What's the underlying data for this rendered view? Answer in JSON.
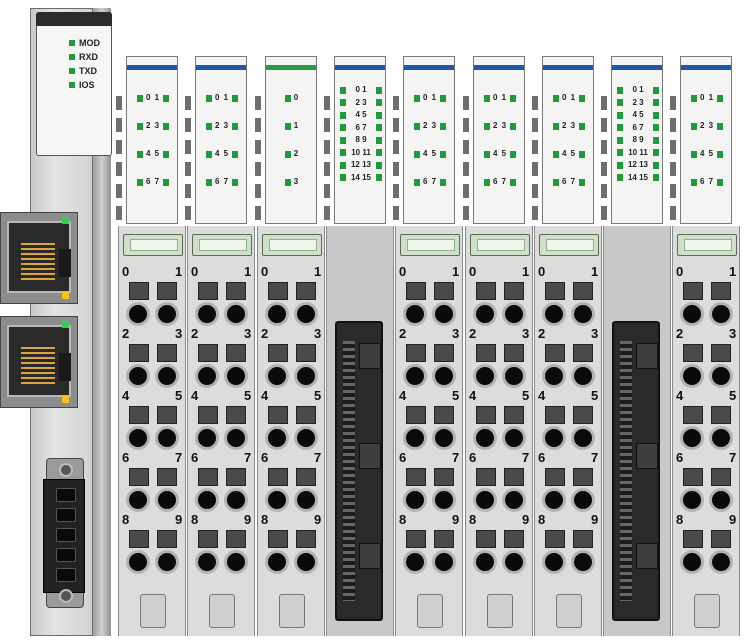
{
  "coupler": {
    "status_leds": [
      {
        "label": "MOD"
      },
      {
        "label": "RXD"
      },
      {
        "label": "TXD"
      },
      {
        "label": "IOS"
      }
    ],
    "led_color": "#1f9b3c"
  },
  "colors": {
    "blue_stripe": "#1f56a6",
    "green_stripe": "#2a9a45",
    "led_green": "#1f9b3c"
  },
  "modules": [
    {
      "type": "8ch",
      "stripe": "blue",
      "leds": [
        "0 1",
        "2 3",
        "4 5",
        "6 7"
      ],
      "terminals": [
        "0",
        "1",
        "2",
        "3",
        "4",
        "5",
        "6",
        "7",
        "8",
        "9"
      ]
    },
    {
      "type": "8ch",
      "stripe": "blue",
      "leds": [
        "0 1",
        "2 3",
        "4 5",
        "6 7"
      ],
      "terminals": [
        "0",
        "1",
        "2",
        "3",
        "4",
        "5",
        "6",
        "7",
        "8",
        "9"
      ]
    },
    {
      "type": "4ch",
      "stripe": "green",
      "leds": [
        "0",
        "1",
        "2",
        "3"
      ],
      "terminals": [
        "0",
        "1",
        "2",
        "3",
        "4",
        "5",
        "6",
        "7",
        "8",
        "9"
      ]
    },
    {
      "type": "16ch",
      "stripe": "blue",
      "leds": [
        "0 1",
        "2 3",
        "4 5",
        "6 7",
        "8 9",
        "10 11",
        "12 13",
        "14 15"
      ],
      "terminals": []
    },
    {
      "type": "8ch",
      "stripe": "blue",
      "leds": [
        "0 1",
        "2 3",
        "4 5",
        "6 7"
      ],
      "terminals": [
        "0",
        "1",
        "2",
        "3",
        "4",
        "5",
        "6",
        "7",
        "8",
        "9"
      ]
    },
    {
      "type": "8ch",
      "stripe": "blue",
      "leds": [
        "0 1",
        "2 3",
        "4 5",
        "6 7"
      ],
      "terminals": [
        "0",
        "1",
        "2",
        "3",
        "4",
        "5",
        "6",
        "7",
        "8",
        "9"
      ]
    },
    {
      "type": "8ch",
      "stripe": "blue",
      "leds": [
        "0 1",
        "2 3",
        "4 5",
        "6 7"
      ],
      "terminals": [
        "0",
        "1",
        "2",
        "3",
        "4",
        "5",
        "6",
        "7",
        "8",
        "9"
      ]
    },
    {
      "type": "16ch",
      "stripe": "blue",
      "leds": [
        "0 1",
        "2 3",
        "4 5",
        "6 7",
        "8 9",
        "10 11",
        "12 13",
        "14 15"
      ],
      "terminals": []
    },
    {
      "type": "8ch",
      "stripe": "blue",
      "leds": [
        "0 1",
        "2 3",
        "4 5",
        "6 7"
      ],
      "terminals": [
        "0",
        "1",
        "2",
        "3",
        "4",
        "5",
        "6",
        "7",
        "8",
        "9"
      ]
    }
  ]
}
